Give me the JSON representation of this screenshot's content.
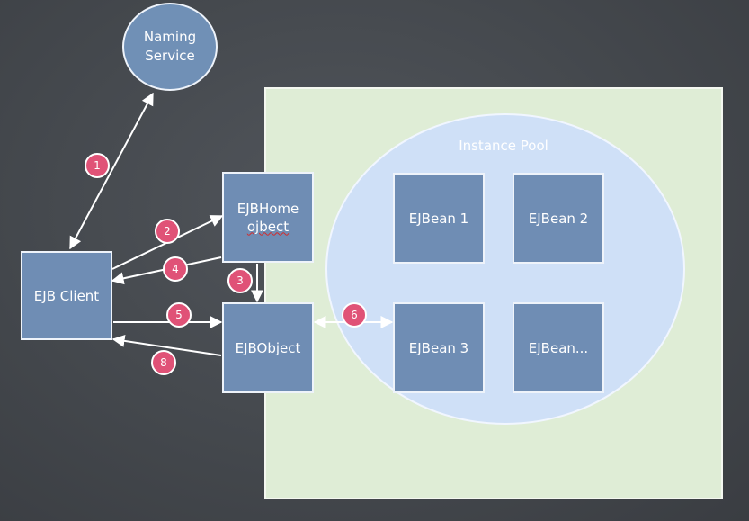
{
  "naming_service": {
    "line1": "Naming",
    "line2": "Service"
  },
  "pool": {
    "label": "Instance Pool"
  },
  "ejb_client": {
    "label": "EJB Client"
  },
  "ejb_home": {
    "line1": "EJBHome",
    "line2": "ojbect"
  },
  "ejb_object": {
    "label": "EJBObject"
  },
  "beans": [
    {
      "label": "EJBean 1"
    },
    {
      "label": "EJBean 2"
    },
    {
      "label": "EJBean 3"
    },
    {
      "label": "EJBean..."
    }
  ],
  "steps": [
    "1",
    "2",
    "4",
    "3",
    "5",
    "8",
    "6"
  ],
  "colors": {
    "background": "#44484d",
    "container": "#dfedd6",
    "pool": "#cfe0f7",
    "box": "#6f8db4",
    "badge": "#e05277",
    "arrow": "#ffffff"
  }
}
